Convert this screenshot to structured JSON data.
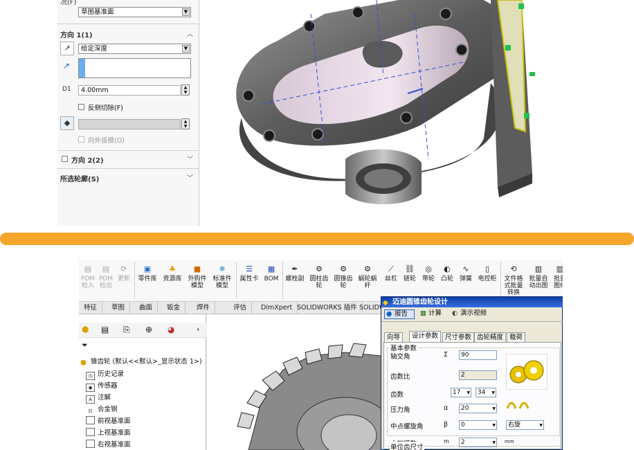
{
  "top": {
    "section0_label": "况(F)",
    "plane_combo": "草图基准面",
    "dir1_title": "方向 1(1)",
    "end_condition": "给定深度",
    "depth_value": "4.00mm",
    "reverse_cut": "反侧切除(F)",
    "draft_out": "向外拔模(O)",
    "dir2_title": "方向 2(2)",
    "contours_title": "所选轮廓(S)"
  },
  "ribbon": {
    "items": [
      {
        "label": "PDM\n检入",
        "dim": true
      },
      {
        "label": "PDM\n检出",
        "dim": true
      },
      {
        "label": "更新",
        "dim": true
      },
      {
        "label": "零件库"
      },
      {
        "label": "资源库"
      },
      {
        "label": "外购件\n模型"
      },
      {
        "label": "标准件\n模型"
      },
      {
        "label": "属性卡"
      },
      {
        "label": "BOM"
      },
      {
        "label": "螺栓副"
      },
      {
        "label": "圆柱齿\n轮"
      },
      {
        "label": "圆锥齿\n轮"
      },
      {
        "label": "蜗轮蜗\n杆"
      },
      {
        "label": "丝杠"
      },
      {
        "label": "链轮"
      },
      {
        "label": "带轮"
      },
      {
        "label": "凸轮"
      },
      {
        "label": "弹簧"
      },
      {
        "label": "电控柜"
      },
      {
        "label": "文件格\n式批量\n转换"
      },
      {
        "label": "批量自\n动出图"
      },
      {
        "label": "批量\n图纸"
      }
    ]
  },
  "tabs": [
    "特征",
    "草图",
    "曲面",
    "钣金",
    "焊件",
    "评估",
    "DimXpert",
    "SOLIDWORKS 插件",
    "SOLIDW"
  ],
  "tree": {
    "root": "锥齿轮 (默认<<默认>_显示状态 1>)",
    "items": [
      "历史记录",
      "传感器",
      "注解",
      "合金钢",
      "前视基准面",
      "上视基准面",
      "右视基准面"
    ]
  },
  "dialog": {
    "title": "迈迪圆锥齿轮设计",
    "btn_report": "报告",
    "btn_calc": "计算",
    "btn_video": "演示视频",
    "tabs": [
      "向导",
      "设计参数",
      "尺寸参数",
      "齿轮精度",
      "载荷"
    ],
    "group_basic": "基本参数",
    "shaft_angle_label": "轴交角",
    "shaft_angle_sym": "Σ",
    "shaft_angle_val": "90",
    "ratio_label": "齿数比",
    "ratio_val": "2",
    "teeth_label": "齿数",
    "teeth1": "17",
    "teeth2": "34",
    "pressure_label": "压力角",
    "pressure_sym": "α",
    "pressure_val": "20",
    "helix_label": "中点螺旋角",
    "helix_sym": "β",
    "helix_val": "0",
    "hand_val": "右旋",
    "module_label": "大端模数",
    "module_sym": "m",
    "module_val": "2",
    "module_unit": "mm",
    "group_unit": "单位齿尺寸"
  }
}
